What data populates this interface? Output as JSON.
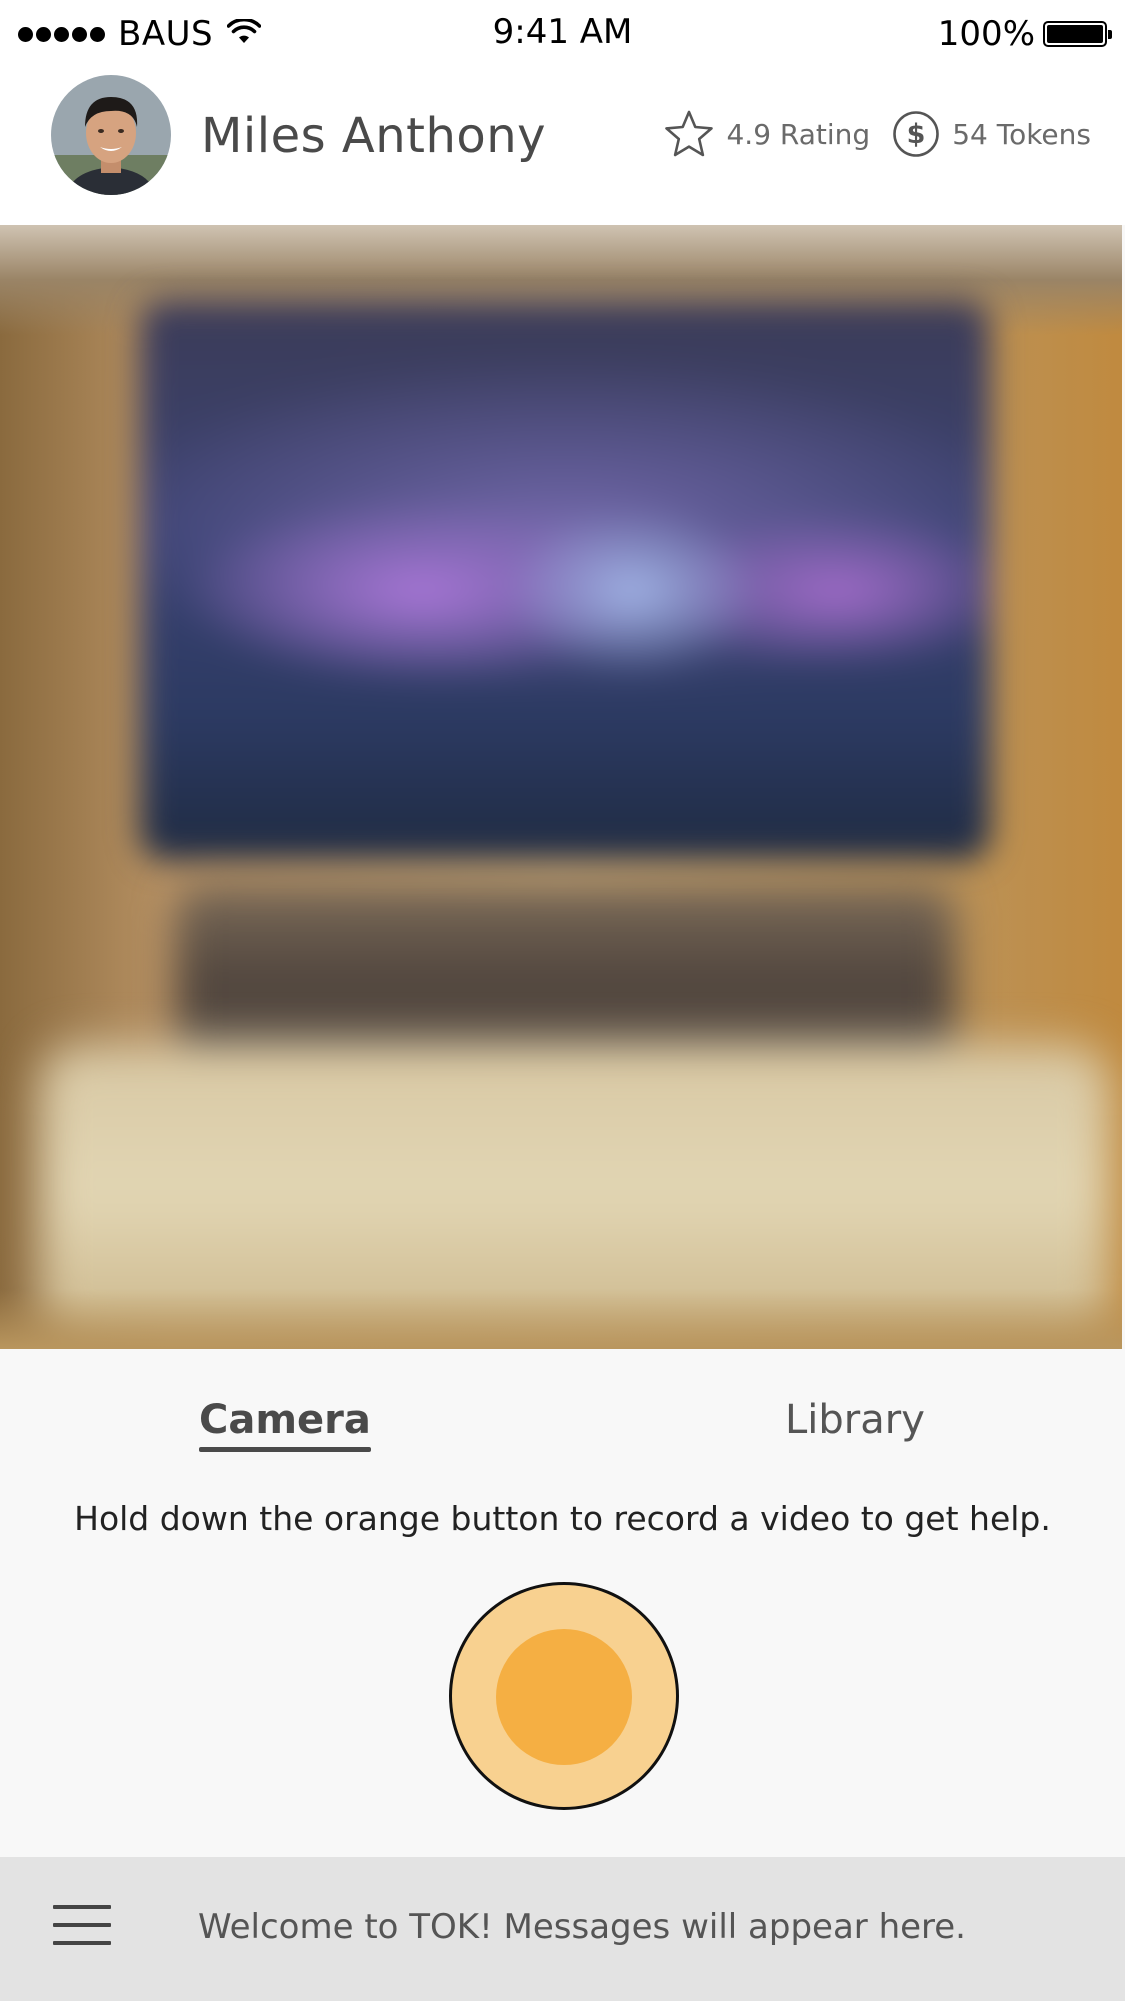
{
  "status_bar": {
    "carrier": "BAUS",
    "time": "9:41 AM",
    "battery": "100%",
    "signal_icon": "signal-dots-icon",
    "wifi_icon": "wifi-icon",
    "battery_icon": "battery-icon"
  },
  "header": {
    "user_name": "Miles Anthony",
    "rating": "4.9 Rating",
    "tokens": "54 Tokens",
    "rating_icon": "star-icon",
    "tokens_icon": "dollar-coin-icon"
  },
  "tabs": [
    {
      "label": "Camera",
      "selected": true
    },
    {
      "label": "Library",
      "selected": false
    }
  ],
  "hint_text": "Hold down the orange button to record a video to get help.",
  "record_button": {
    "outer_color": "#f8d190",
    "inner_color": "#f5af43"
  },
  "bottom_bar": {
    "menu_icon": "hamburger-menu-icon",
    "message": "Welcome to TOK! Messages will appear here."
  }
}
